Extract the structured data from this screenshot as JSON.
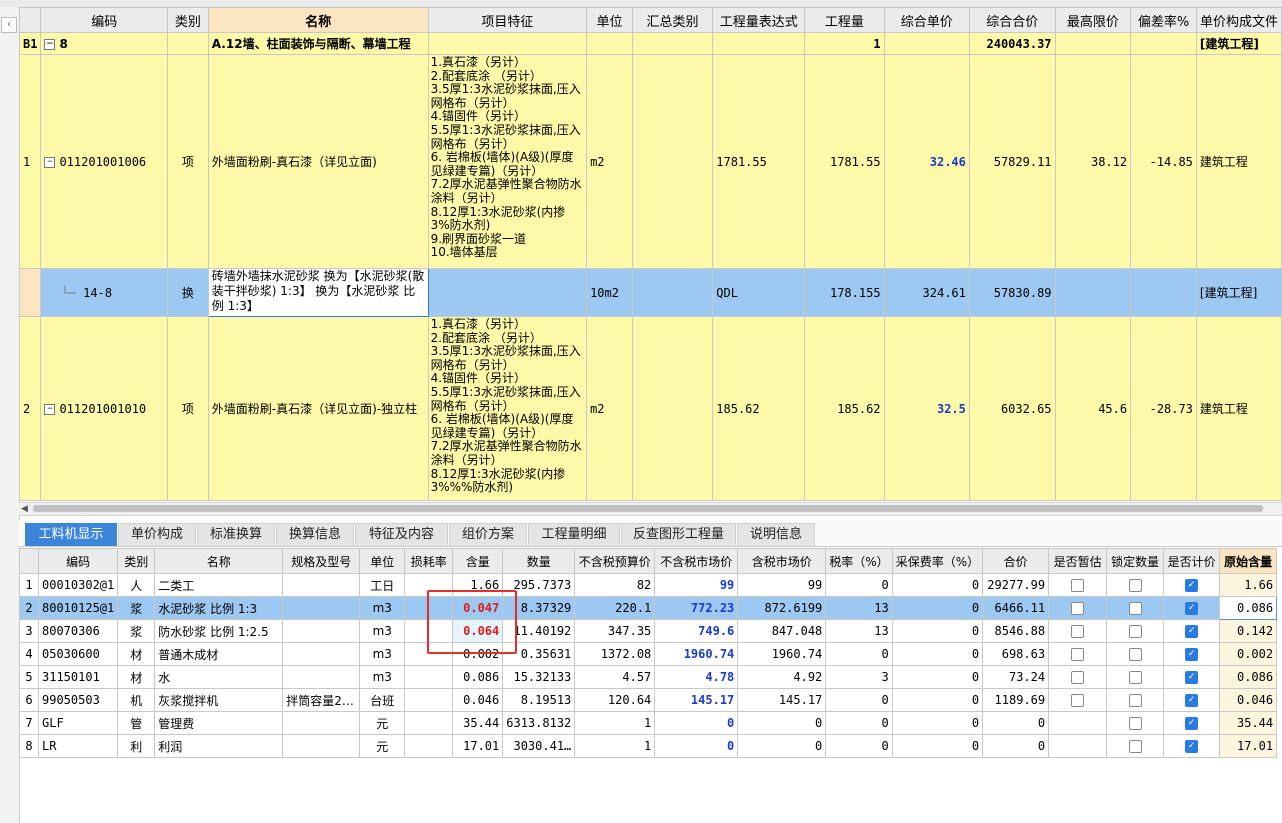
{
  "upper": {
    "columns": [
      "编码",
      "类别",
      "名称",
      "项目特征",
      "单位",
      "汇总类别",
      "工程量表达式",
      "工程量",
      "综合单价",
      "综合合价",
      "最高限价",
      "偏差率%",
      "单价构成文件"
    ],
    "section": {
      "row": "B1",
      "code": "8",
      "name": "A.12墙、柱面装饰与隔断、幕墙工程",
      "qty": "1",
      "total": "240043.37",
      "file": "[建筑工程]"
    },
    "rows": [
      {
        "row": "1",
        "code": "011201001006",
        "type": "项",
        "name": "外墙面粉刷-真石漆（详见立面)",
        "features": [
          "1.真石漆（另计）",
          "2.配套底涂 （另计）",
          "3.5厚1:3水泥砂浆抹面,压入网格布（另计）",
          "4.锚固件（另计）",
          "5.5厚1:3水泥砂浆抹面,压入网格布（另计）",
          "6. 岩棉板(墙体)(A级)(厚度见绿建专篇)（另计）",
          "7.2厚水泥基弹性聚合物防水涂料（另计）",
          "8.12厚1:3水泥砂浆(内掺3%防水剂)",
          "9.刷界面砂浆一道",
          "10.墙体基层"
        ],
        "unit": "m2",
        "expr": "1781.55",
        "qty": "1781.55",
        "price": "32.46",
        "total": "57829.11",
        "limit": "38.12",
        "dev": "-14.85",
        "file": "建筑工程"
      },
      {
        "row": "",
        "code": "14-8",
        "type": "换",
        "name": "砖墙外墙抹水泥砂浆  换为【水泥砂浆(散装干拌砂浆) 1:3】    换为【水泥砂浆 比例 1:3】",
        "unit": "10m2",
        "expr": "QDL",
        "qty": "178.155",
        "price": "324.61",
        "total": "57830.89",
        "file": "[建筑工程]"
      },
      {
        "row": "2",
        "code": "011201001010",
        "type": "项",
        "name": "外墙面粉刷-真石漆（详见立面)-独立柱",
        "features": [
          "1.真石漆（另计）",
          "2.配套底涂 （另计）",
          "3.5厚1:3水泥砂浆抹面,压入网格布（另计）",
          "4.锚固件（另计）",
          "5.5厚1:3水泥砂浆抹面,压入网格布（另计）",
          "6. 岩棉板(墙体)(A级)(厚度见绿建专篇)（另计）",
          "7.2厚水泥基弹性聚合物防水涂料（另计）",
          "8.12厚1:3水泥砂浆(内掺3%%%防水剂)"
        ],
        "unit": "m2",
        "expr": "185.62",
        "qty": "185.62",
        "price": "32.5",
        "total": "6032.65",
        "limit": "45.6",
        "dev": "-28.73",
        "file": "建筑工程"
      }
    ]
  },
  "tabs": [
    "工料机显示",
    "单价构成",
    "标准换算",
    "换算信息",
    "特征及内容",
    "组价方案",
    "工程量明细",
    "反查图形工程量",
    "说明信息"
  ],
  "lower": {
    "columns": [
      "编码",
      "类别",
      "名称",
      "规格及型号",
      "单位",
      "损耗率",
      "含量",
      "数量",
      "不含税预算价",
      "不含税市场价",
      "含税市场价",
      "税率（%）",
      "采保费率（%）",
      "合价",
      "是否暂估",
      "锁定数量",
      "是否计价",
      "原始含量"
    ],
    "rows": [
      {
        "n": "1",
        "code": "00010302@1",
        "type": "人",
        "name": "二类工",
        "spec": "",
        "unit": "工日",
        "content": "1.66",
        "qty": "295.7373",
        "budget": "82",
        "market": "99",
        "taxmarket": "99",
        "tax": "0",
        "fee": "0",
        "total": "29277.99",
        "orig": "1.66"
      },
      {
        "n": "2",
        "code": "80010125@1",
        "type": "浆",
        "name": "水泥砂浆 比例 1:3",
        "spec": "",
        "unit": "m3",
        "content": "0.047",
        "qty": "8.37329",
        "budget": "220.1",
        "market": "772.23",
        "taxmarket": "872.6199",
        "tax": "13",
        "fee": "0",
        "total": "6466.11",
        "orig": "0.086"
      },
      {
        "n": "3",
        "code": "80070306",
        "type": "浆",
        "name": "防水砂浆 比例 1:2.5",
        "spec": "",
        "unit": "m3",
        "content": "0.064",
        "qty": "11.40192",
        "budget": "347.35",
        "market": "749.6",
        "taxmarket": "847.048",
        "tax": "13",
        "fee": "0",
        "total": "8546.88",
        "orig": "0.142"
      },
      {
        "n": "4",
        "code": "05030600",
        "type": "材",
        "name": "普通木成材",
        "spec": "",
        "unit": "m3",
        "content": "0.002",
        "qty": "0.35631",
        "budget": "1372.08",
        "market": "1960.74",
        "taxmarket": "1960.74",
        "tax": "0",
        "fee": "0",
        "total": "698.63",
        "orig": "0.002"
      },
      {
        "n": "5",
        "code": "31150101",
        "type": "材",
        "name": "水",
        "spec": "",
        "unit": "m3",
        "content": "0.086",
        "qty": "15.32133",
        "budget": "4.57",
        "market": "4.78",
        "taxmarket": "4.92",
        "tax": "3",
        "fee": "0",
        "total": "73.24",
        "orig": "0.086"
      },
      {
        "n": "6",
        "code": "99050503",
        "type": "机",
        "name": "灰浆搅拌机",
        "spec": "拌筒容量2…",
        "unit": "台班",
        "content": "0.046",
        "qty": "8.19513",
        "budget": "120.64",
        "market": "145.17",
        "taxmarket": "145.17",
        "tax": "0",
        "fee": "0",
        "total": "1189.69",
        "orig": "0.046"
      },
      {
        "n": "7",
        "code": "GLF",
        "type": "管",
        "name": "管理费",
        "spec": "",
        "unit": "元",
        "content": "35.44",
        "qty": "6313.8132",
        "budget": "1",
        "market": "0",
        "taxmarket": "0",
        "tax": "0",
        "fee": "0",
        "total": "0",
        "orig": "35.44"
      },
      {
        "n": "8",
        "code": "LR",
        "type": "利",
        "name": "利润",
        "spec": "",
        "unit": "元",
        "content": "17.01",
        "qty": "3030.41…",
        "budget": "1",
        "market": "0",
        "taxmarket": "0",
        "tax": "0",
        "fee": "0",
        "total": "0",
        "orig": "17.01"
      }
    ]
  },
  "colors": {
    "yellow_row": "#fdf9a8",
    "selected_row": "#9cc8f2",
    "active_tab": "#3c86d9",
    "highlight_box": "#e0312b"
  }
}
